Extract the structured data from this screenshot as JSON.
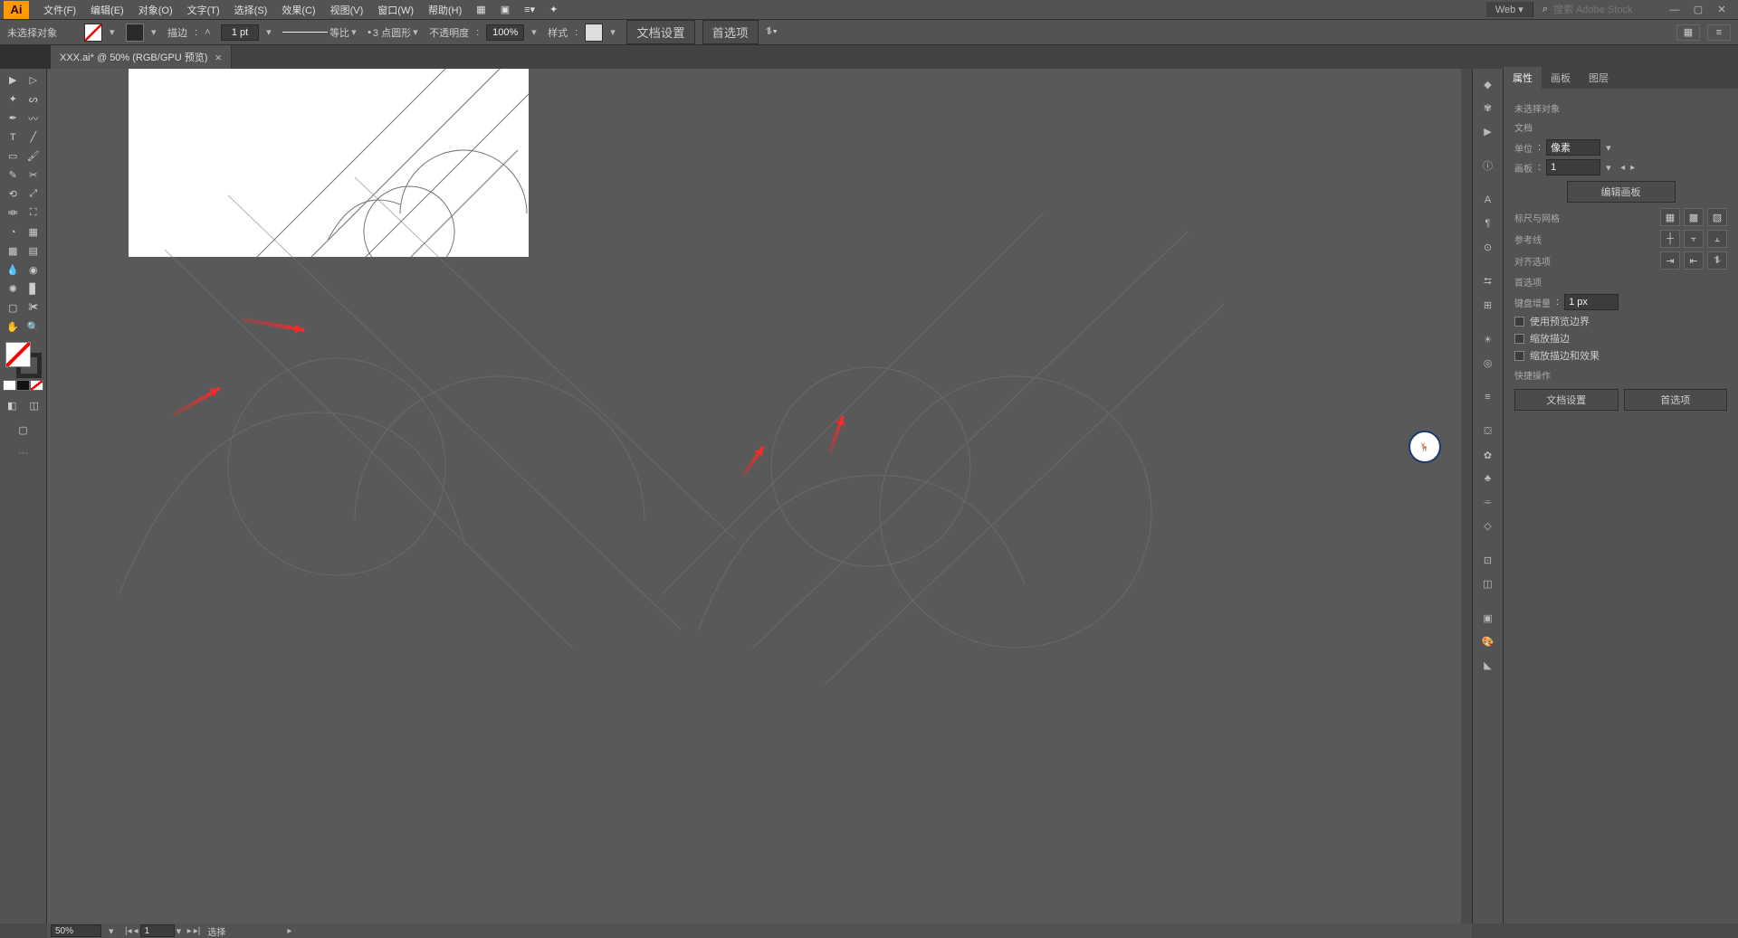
{
  "app": {
    "logo": "Ai"
  },
  "menu": {
    "file": "文件(F)",
    "edit": "编辑(E)",
    "object": "对象(O)",
    "type": "文字(T)",
    "select": "选择(S)",
    "effect": "效果(C)",
    "view": "视图(V)",
    "window": "窗口(W)",
    "help": "帮助(H)",
    "workspace": "Web",
    "search_placeholder": "搜索 Adobe Stock"
  },
  "ctrl": {
    "no_selection": "未选择对象",
    "stroke_label": "描边",
    "stroke_weight": "1 pt",
    "stroke_style": "等比",
    "dash": "3 点圆形",
    "opacity_label": "不透明度",
    "opacity_value": "100%",
    "style_label": "样式",
    "doc_setup": "文档设置",
    "prefs": "首选项"
  },
  "doc": {
    "tab_title": "XXX.ai* @ 50% (RGB/GPU 预览)"
  },
  "statusbar": {
    "zoom": "50%",
    "artboard_num": "1",
    "mode": "选择"
  },
  "properties": {
    "tab_props": "属性",
    "tab_artboards": "画板",
    "tab_layers": "图层",
    "no_selection": "未选择对象",
    "section_doc": "文档",
    "units_label": "单位",
    "units_value": "像素",
    "artboard_label": "画板",
    "artboard_value": "1",
    "edit_artboards": "编辑画板",
    "rulers_grid": "标尺与网格",
    "guides": "参考线",
    "snap": "对齐选项",
    "prefs_section": "首选项",
    "key_inc_label": "键盘增量",
    "key_inc_value": "1 px",
    "use_preview_bounds": "使用预览边界",
    "scale_strokes": "缩放描边",
    "scale_effects": "缩放描边和效果",
    "quick_actions": "快捷操作",
    "doc_setup_btn": "文档设置",
    "prefs_btn": "首选项"
  }
}
